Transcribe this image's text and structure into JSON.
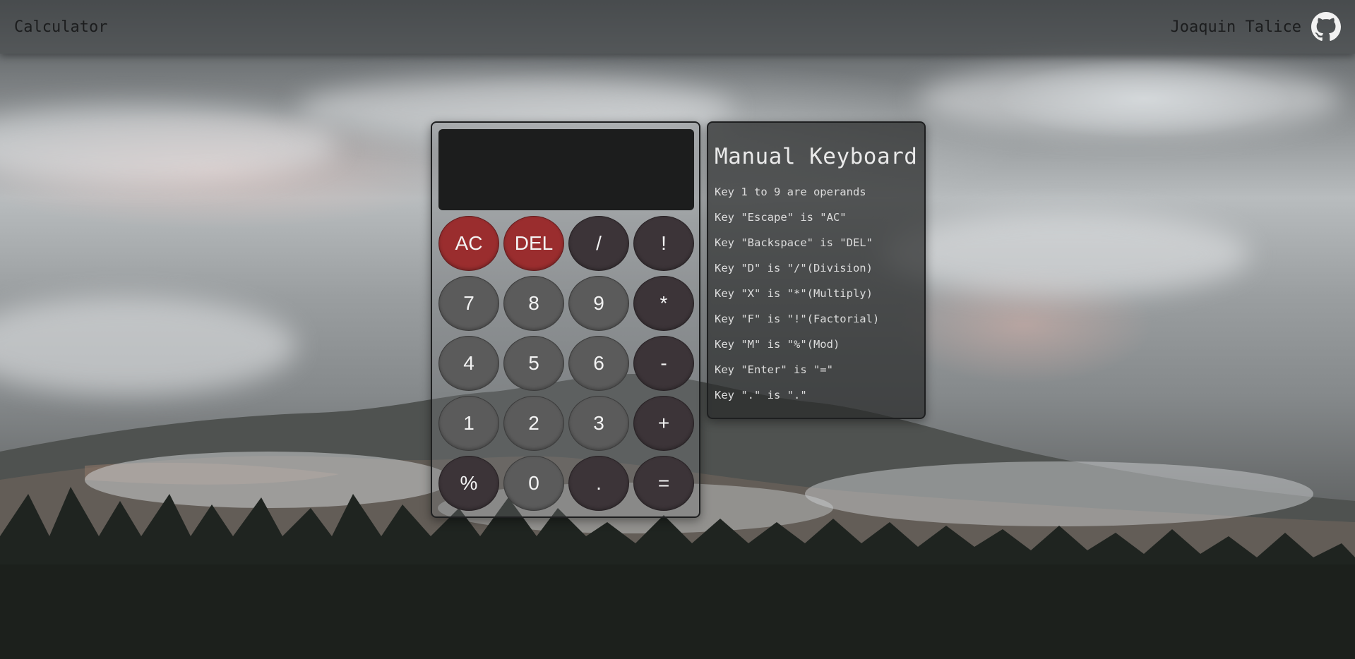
{
  "header": {
    "title": "Calculator",
    "author": "Joaquin Talice",
    "github_icon": "github-icon"
  },
  "calculator": {
    "display_value": "",
    "keys": [
      {
        "label": "AC",
        "style": "red"
      },
      {
        "label": "DEL",
        "style": "red"
      },
      {
        "label": "/",
        "style": "op"
      },
      {
        "label": "!",
        "style": "op"
      },
      {
        "label": "7",
        "style": "num"
      },
      {
        "label": "8",
        "style": "num"
      },
      {
        "label": "9",
        "style": "num"
      },
      {
        "label": "*",
        "style": "op"
      },
      {
        "label": "4",
        "style": "num"
      },
      {
        "label": "5",
        "style": "num"
      },
      {
        "label": "6",
        "style": "num"
      },
      {
        "label": "-",
        "style": "op"
      },
      {
        "label": "1",
        "style": "num"
      },
      {
        "label": "2",
        "style": "num"
      },
      {
        "label": "3",
        "style": "num"
      },
      {
        "label": "+",
        "style": "op"
      },
      {
        "label": "%",
        "style": "op"
      },
      {
        "label": "0",
        "style": "num"
      },
      {
        "label": ".",
        "style": "op"
      },
      {
        "label": "=",
        "style": "op"
      }
    ]
  },
  "manual": {
    "title": "Manual Keyboard",
    "lines": [
      "Key 1 to 9 are operands",
      "Key \"Escape\" is \"AC\"",
      "Key \"Backspace\" is \"DEL\"",
      "Key \"D\" is \"/\"(Division)",
      "Key \"X\" is \"*\"(Multiply)",
      "Key \"F\" is \"!\"(Factorial)",
      "Key \"M\" is \"%\"(Mod)",
      "Key \"Enter\" is \"=\"",
      "Key \".\" is \".\""
    ]
  },
  "colors": {
    "red_key": "#9a2d2e",
    "number_key": "#5b5b5b",
    "operator_key": "#3c3438",
    "display": "#1c1d1d"
  }
}
